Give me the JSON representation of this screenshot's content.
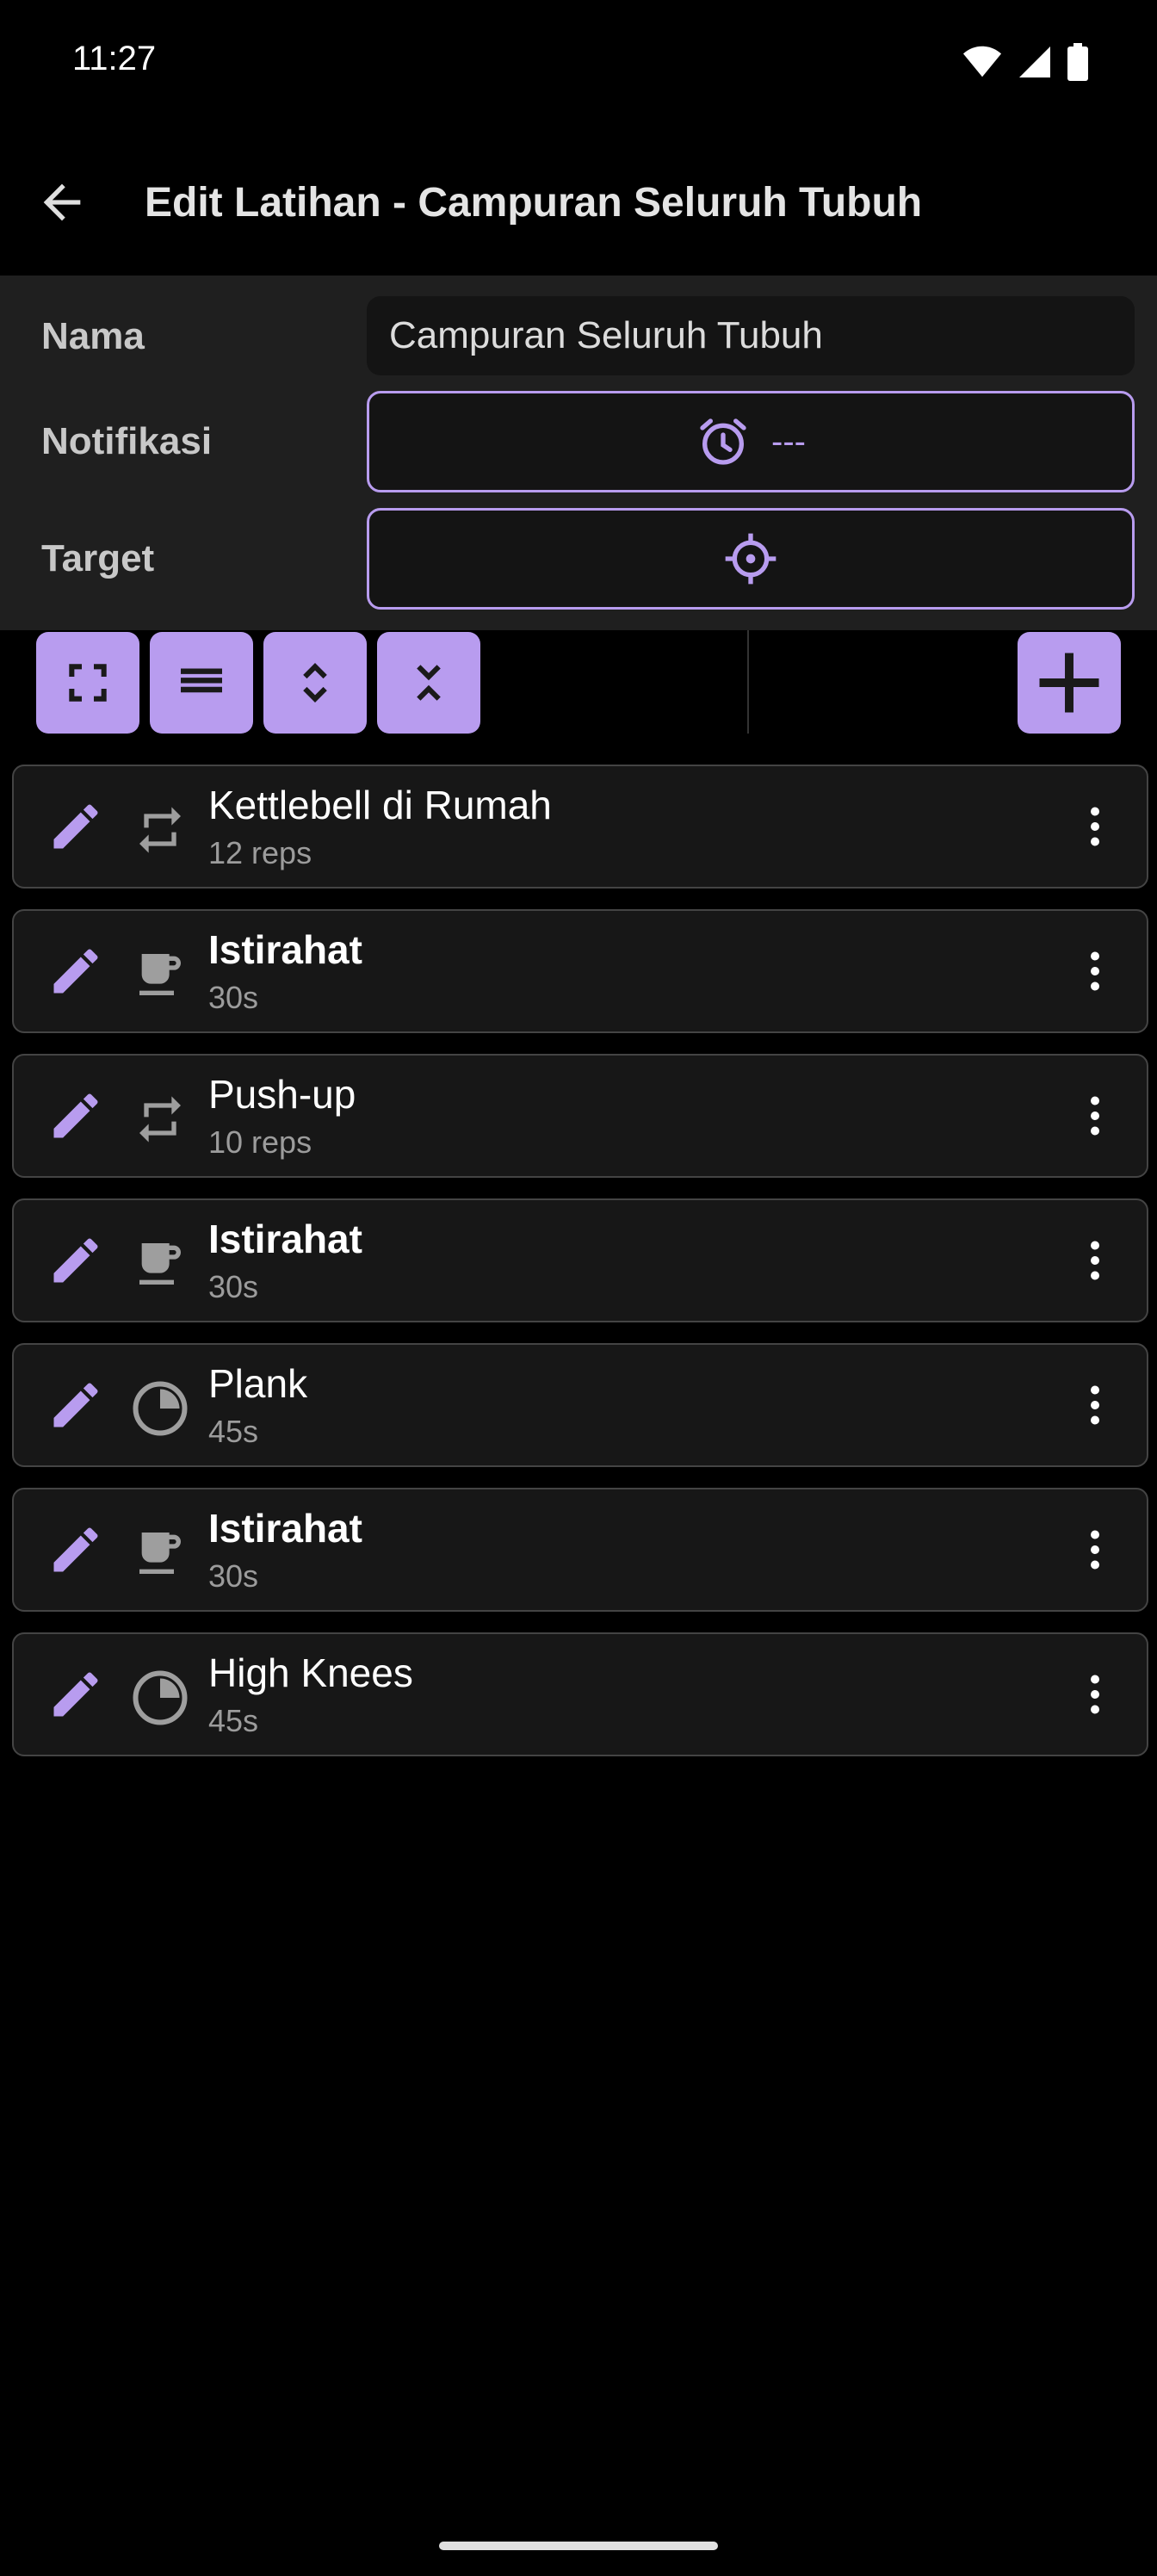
{
  "status": {
    "time": "11:27"
  },
  "header": {
    "title": "Edit Latihan - Campuran Seluruh Tubuh"
  },
  "form": {
    "name_label": "Nama",
    "name_value": "Campuran Seluruh Tubuh",
    "notification_label": "Notifikasi",
    "notification_value": "---",
    "target_label": "Target"
  },
  "items": [
    {
      "title": "Kettlebell di Rumah",
      "subtitle": "12 reps",
      "type": "repeat-icon"
    },
    {
      "title": "Istirahat",
      "subtitle": "30s",
      "type": "coffee-cup-icon"
    },
    {
      "title": "Push-up",
      "subtitle": "10 reps",
      "type": "repeat-icon"
    },
    {
      "title": "Istirahat",
      "subtitle": "30s",
      "type": "coffee-cup-icon"
    },
    {
      "title": "Plank",
      "subtitle": "45s",
      "type": "timer-pie-icon"
    },
    {
      "title": "Istirahat",
      "subtitle": "30s",
      "type": "coffee-cup-icon"
    },
    {
      "title": "High Knees",
      "subtitle": "45s",
      "type": "timer-pie-icon"
    }
  ],
  "colors": {
    "accent": "#b89cef",
    "background": "#000000",
    "panel": "#1f1f1f",
    "card": "#171717"
  }
}
